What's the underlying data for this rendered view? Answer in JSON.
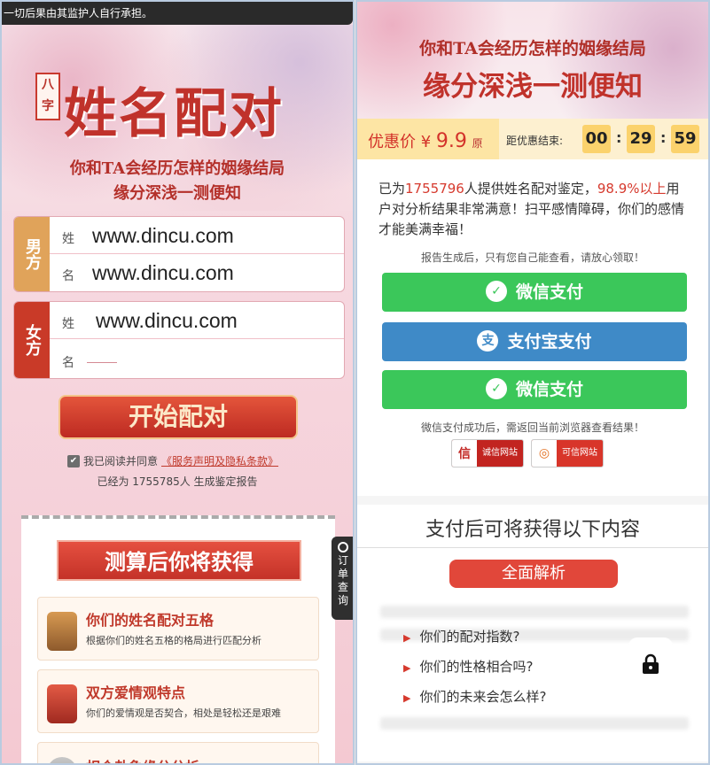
{
  "left": {
    "notice": "一切后果由其监护人自行承担。",
    "badge": "八字",
    "title": "姓名配对",
    "subtitle1": "你和TA会经历怎样的姻缘结局",
    "subtitle2": "缘分深浅一测便知",
    "male": {
      "side_label": "男方",
      "surname_label": "姓",
      "surname_value": "www.dincu.com",
      "name_label": "名",
      "name_value": "www.dincu.com"
    },
    "female": {
      "side_label": "女方",
      "surname_label": "姓",
      "surname_value": "www.dincu.com",
      "name_label": "名",
      "name_value": ""
    },
    "start_button": "开始配对",
    "agree_text": "我已阅读并同意",
    "agree_link": "《服务声明及隐私条款》",
    "count_text": "已经为 1755785人 生成鉴定报告",
    "results_title": "测算后你将获得",
    "items": [
      {
        "title": "你们的姓名配对五格",
        "desc": "根据你们的姓名五格的格局进行匹配分析"
      },
      {
        "title": "双方爱情观特点",
        "desc": "你们的爱情观是否契合，相处是轻松还是艰难"
      },
      {
        "title": "相合卦象缘分分析",
        "desc": ""
      }
    ],
    "side_tab": "订单查询"
  },
  "right": {
    "headline1": "你和TA会经历怎样的姻缘结局",
    "headline2": "缘分深浅一测便知",
    "price_label": "优惠价",
    "price_currency": "¥",
    "price_value": "9.9",
    "price_orig": "原",
    "timer_label": "距优惠结束:",
    "timer": [
      "00",
      "29",
      "59"
    ],
    "para_prefix": "已为",
    "para_count": "1755796",
    "para_mid": "人提供姓名配对鉴定，",
    "para_rate": "98.9%以上",
    "para_suffix": "用户对分析结果非常满意！扫平感情障碍，你们的感情才能美满幸福！",
    "report_tip": "报告生成后，只有您自己能查看，请放心领取！",
    "pay_wechat": "微信支付",
    "pay_alipay": "支付宝支付",
    "pay_tip": "微信支付成功后，需返回当前浏览器查看结果！",
    "cert1": "诚信网站",
    "cert2": "可信网站",
    "after_title": "支付后可将获得以下内容",
    "pill": "全面解析",
    "questions": [
      "你们的配对指数?",
      "你们的性格相合吗?",
      "你们的未来会怎么样?"
    ]
  }
}
